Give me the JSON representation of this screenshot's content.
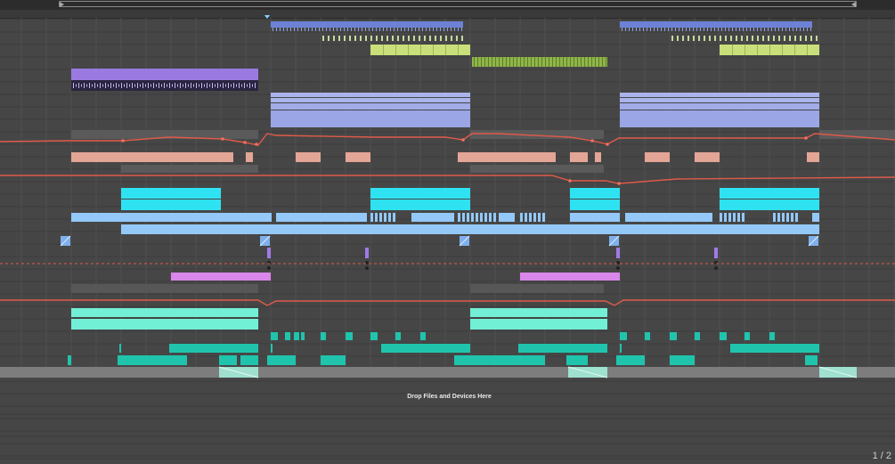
{
  "arrangement": {
    "drop_zone_text": "Drop Files and Devices Here",
    "page_indicator": "1 / 2"
  },
  "colors": {
    "background": "#464646",
    "automation_line": "#e05a4a",
    "blue_clip": "#6d82d6",
    "lime_clip": "#c9df7a",
    "green_clip": "#8fb54a",
    "purple_clip": "#9a7ae0",
    "periwinkle_clip": "#9aa6e6",
    "salmon_clip": "#e3a596",
    "cyan_clip": "#2fe2f2",
    "light_blue_clip": "#93c8f8",
    "magenta_clip": "#d987ea",
    "aqua_clip": "#72f0d6",
    "teal_clip": "#20c4ad"
  }
}
